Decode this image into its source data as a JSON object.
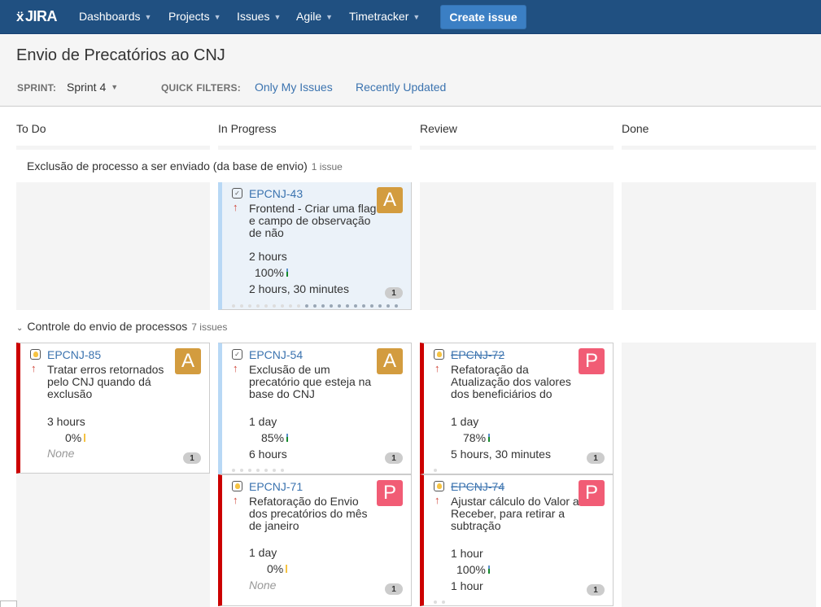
{
  "header": {
    "logo": "JIRA",
    "nav": [
      {
        "label": "Dashboards"
      },
      {
        "label": "Projects"
      },
      {
        "label": "Issues"
      },
      {
        "label": "Agile"
      },
      {
        "label": "Timetracker"
      }
    ],
    "create_label": "Create issue"
  },
  "board": {
    "title": "Envio de Precatórios ao CNJ",
    "sprint_label": "SPRINT:",
    "sprint_value": "Sprint 4",
    "quick_filters_label": "QUICK FILTERS:",
    "quick_filters": [
      "Only My Issues",
      "Recently Updated"
    ],
    "columns": [
      "To Do",
      "In Progress",
      "Review",
      "Done"
    ]
  },
  "swimlanes": [
    {
      "title": "Exclusão de processo a ser enviado (da base de envio)",
      "count": "1 issue",
      "cards": [
        {
          "key": "EPCNJ-43",
          "type": "task",
          "summary": "Frontend - Criar uma flag e campo de observação de não",
          "assignee": "A",
          "estimate": "2 hours",
          "progress": "100%",
          "remaining": "2 hours, 30 minutes",
          "badge": "1",
          "column": "In Progress",
          "done": false
        }
      ]
    },
    {
      "title": "Controle do envio de processos",
      "count": "7 issues",
      "cards": [
        {
          "key": "EPCNJ-85",
          "type": "improvement",
          "summary": "Tratar erros retornados pelo CNJ quando dá exclusão",
          "assignee": "A",
          "estimate": "3 hours",
          "progress": "0%",
          "remaining": "None",
          "badge": "1",
          "column": "To Do",
          "done": false
        },
        {
          "key": "EPCNJ-54",
          "type": "task",
          "summary": "Exclusão de um precatório que esteja na base do CNJ",
          "assignee": "A",
          "estimate": "1 day",
          "progress": "85%",
          "remaining": "6 hours",
          "badge": "1",
          "column": "In Progress",
          "done": false
        },
        {
          "key": "EPCNJ-72",
          "type": "improvement",
          "summary": "Refatoração da Atualização dos valores dos beneficiários do",
          "assignee": "P",
          "estimate": "1 day",
          "progress": "78%",
          "remaining": "5 hours, 30 minutes",
          "badge": "1",
          "column": "Review",
          "done": true
        },
        {
          "key": "EPCNJ-71",
          "type": "improvement",
          "summary": "Refatoração do Envio dos precatórios do mês de janeiro",
          "assignee": "P",
          "estimate": "1 day",
          "progress": "0%",
          "remaining": "None",
          "badge": "1",
          "column": "In Progress",
          "done": false
        },
        {
          "key": "EPCNJ-74",
          "type": "improvement",
          "summary": "Ajustar cálculo do Valor a Receber, para retirar a subtração",
          "assignee": "P",
          "estimate": "1 hour",
          "progress": "100%",
          "remaining": "1 hour",
          "badge": "1",
          "column": "Review",
          "done": true
        }
      ]
    }
  ],
  "colors": {
    "header_bg": "#205081",
    "create_btn": "#3b7fc4",
    "link": "#3b73af",
    "avatar_A": "#d39c3f",
    "avatar_P": "#f15c75",
    "epic_red": "#cc0000",
    "epic_blue": "#b8d8f5",
    "priority": "#d04437"
  }
}
